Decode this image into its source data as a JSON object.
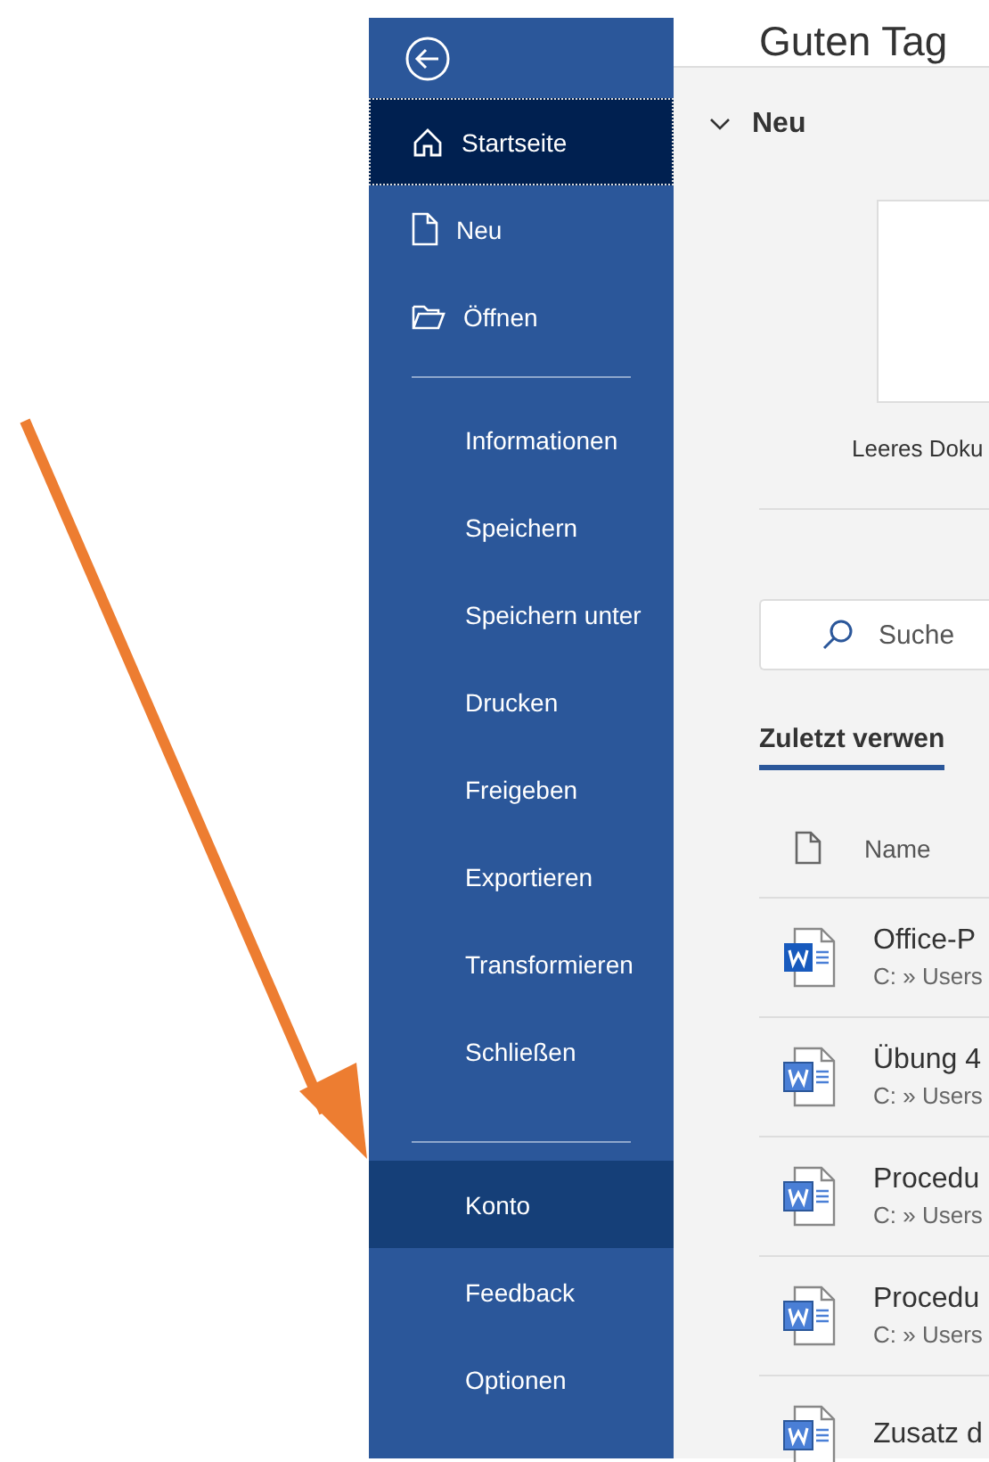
{
  "sidebar": {
    "top_items": [
      {
        "label": "Startseite",
        "kind": "home",
        "selected": true,
        "hovered": false
      },
      {
        "label": "Neu",
        "kind": "file",
        "selected": false,
        "hovered": false
      },
      {
        "label": "Öffnen",
        "kind": "folder",
        "selected": false,
        "hovered": false
      }
    ],
    "middle_items": [
      {
        "label": "Informationen",
        "selected": false,
        "hovered": false
      },
      {
        "label": "Speichern",
        "selected": false,
        "hovered": false
      },
      {
        "label": "Speichern unter",
        "selected": false,
        "hovered": false
      },
      {
        "label": "Drucken",
        "selected": false,
        "hovered": false
      },
      {
        "label": "Freigeben",
        "selected": false,
        "hovered": false
      },
      {
        "label": "Exportieren",
        "selected": false,
        "hovered": false
      },
      {
        "label": "Transformieren",
        "selected": false,
        "hovered": false
      },
      {
        "label": "Schließen",
        "selected": false,
        "hovered": false
      }
    ],
    "bottom_items": [
      {
        "label": "Konto",
        "selected": false,
        "hovered": true
      },
      {
        "label": "Feedback",
        "selected": false,
        "hovered": false
      },
      {
        "label": "Optionen",
        "selected": false,
        "hovered": false
      }
    ]
  },
  "main": {
    "greeting": "Guten Tag",
    "new_section": {
      "title": "Neu",
      "expanded": true,
      "template_label": "Leeres Doku"
    },
    "search": {
      "placeholder": "Suche"
    },
    "recent_tab": "Zuletzt verwen",
    "table": {
      "column_name": "Name",
      "rows": [
        {
          "name": "Office-P",
          "path": "C: » Users",
          "kind": "new"
        },
        {
          "name": "Übung 4",
          "path": "C: » Users",
          "kind": "old"
        },
        {
          "name": "Procedu",
          "path": "C: » Users",
          "kind": "old"
        },
        {
          "name": "Procedu",
          "path": "C: » Users",
          "kind": "old"
        },
        {
          "name": "Zusatz d",
          "kind": "old"
        }
      ]
    }
  }
}
